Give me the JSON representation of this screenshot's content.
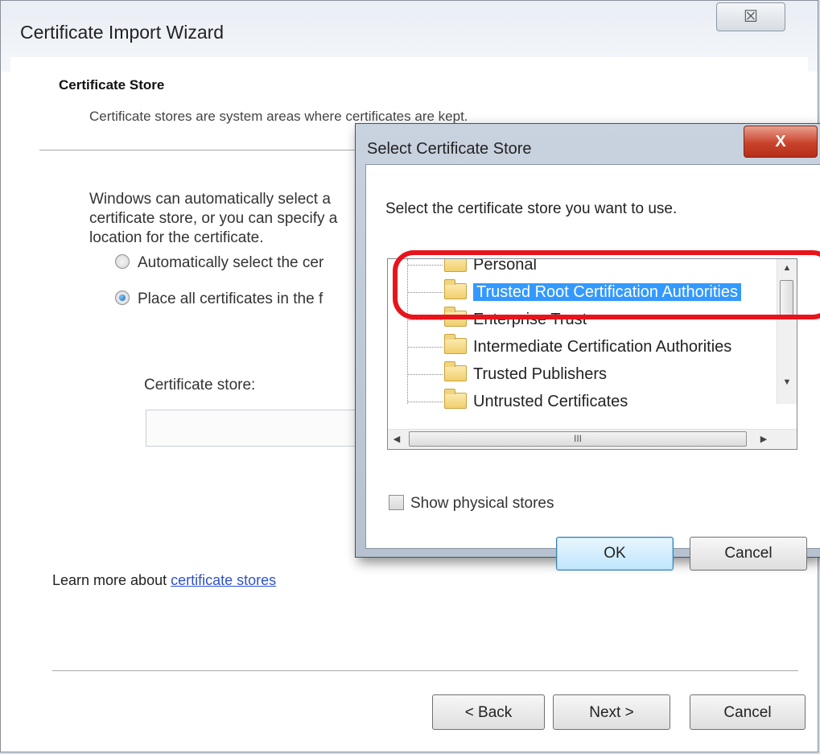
{
  "wizard": {
    "title": "Certificate Import Wizard",
    "close_symbol": "☒",
    "section_title": "Certificate Store",
    "section_desc": "Certificate stores are system areas where certificates are kept.",
    "intro": "Windows can automatically select a certificate store, or you can specify a location for the certificate.",
    "radio_auto": "Automatically select the cer",
    "radio_place": "Place all certificates in the f",
    "store_label": "Certificate store:",
    "store_value": "",
    "learn_prefix": "Learn more about ",
    "learn_link": "certificate stores",
    "back_label": "< Back",
    "next_label": "Next >",
    "cancel_label": "Cancel"
  },
  "dialog": {
    "title": "Select Certificate Store",
    "close_symbol": "X",
    "prompt": "Select the certificate store you want to use.",
    "stores": [
      {
        "label": "Personal",
        "selected": false
      },
      {
        "label": "Trusted Root Certification Authorities",
        "selected": true
      },
      {
        "label": "Enterprise Trust",
        "selected": false
      },
      {
        "label": "Intermediate Certification Authorities",
        "selected": false
      },
      {
        "label": "Trusted Publishers",
        "selected": false
      },
      {
        "label": "Untrusted Certificates",
        "selected": false
      }
    ],
    "hscroll_grip": "III",
    "show_physical": "Show physical stores",
    "ok_label": "OK",
    "cancel_label": "Cancel"
  },
  "colors": {
    "selection": "#3399ff",
    "highlight_annotation": "#e8141b",
    "link": "#2f52c9"
  }
}
